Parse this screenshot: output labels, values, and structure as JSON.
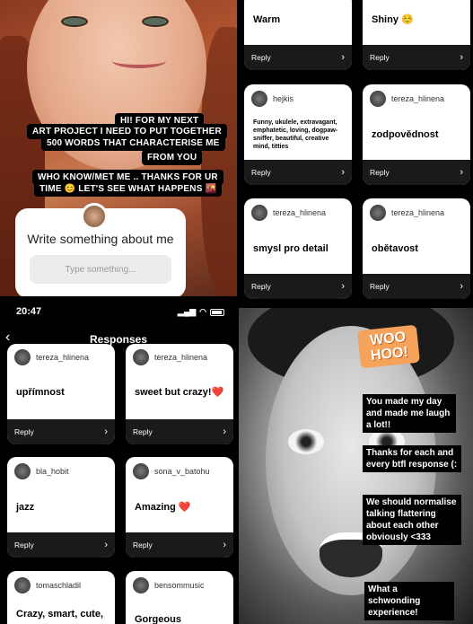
{
  "story_question": {
    "lines": [
      "HI! FOR MY NEXT",
      "ART PROJECT I NEED TO PUT TOGETHER",
      "500 WORDS THAT CHARACTERISE ME",
      "FROM YOU",
      "WHO KNOW/MET ME .. THANKS FOR  UR",
      "TIME 😊  LET'S SEE WHAT HAPPENS 🌇"
    ],
    "card_title": "Write something about me",
    "input_placeholder": "Type something..."
  },
  "grid_top": {
    "cards": [
      {
        "user": "",
        "text": "Warm",
        "reply": "Reply"
      },
      {
        "user": "",
        "text": "Shiny ☺️",
        "reply": "Reply"
      },
      {
        "user": "hejkis",
        "text": "Funny, ukulele, extravagant, emphatetic, loving, dogpaw-sniffer, beautiful, creative mind, titties",
        "reply": "Reply"
      },
      {
        "user": "tereza_hlinena",
        "text": "zodpovědnost",
        "reply": "Reply"
      },
      {
        "user": "tereza_hlinena",
        "text": "smysl pro detail",
        "reply": "Reply"
      },
      {
        "user": "tereza_hlinena",
        "text": "obětavost",
        "reply": "Reply"
      }
    ]
  },
  "responses_screen": {
    "status_time": "20:47",
    "title": "Responses",
    "cards": [
      {
        "user": "tereza_hlinena",
        "text": "upřímnost",
        "reply": "Reply"
      },
      {
        "user": "tereza_hlinena",
        "text": "sweet but crazy!❤️",
        "reply": "Reply"
      },
      {
        "user": "bla_hobit",
        "text": "jazz",
        "reply": "Reply"
      },
      {
        "user": "sona_v_batohu",
        "text": "Amazing ❤️",
        "reply": "Reply"
      },
      {
        "user": "tomaschladil",
        "text": "Crazy, smart, cute,",
        "reply": ""
      },
      {
        "user": "bensommusic",
        "text": "Gorgeous",
        "reply": ""
      }
    ]
  },
  "story_thanks": {
    "sticker": "WOO HOO!",
    "messages": [
      "You made my day and made me laugh a lot!!",
      "Thanks for each and every btfl response (:",
      "We should normalise talking flattering about each other obviously <333",
      "What a schwonding experience!"
    ]
  }
}
